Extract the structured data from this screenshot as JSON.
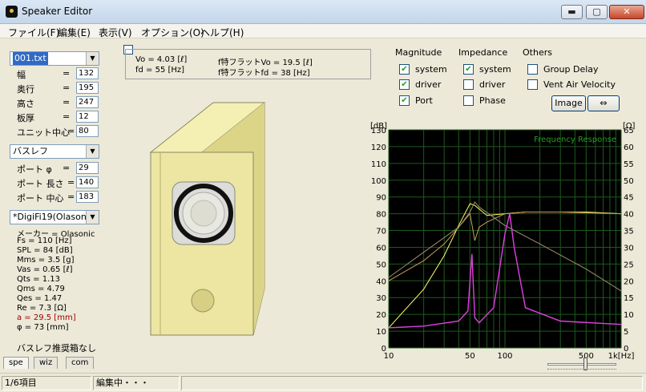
{
  "window": {
    "title": "Speaker Editor",
    "min": "▬",
    "max": "▢",
    "close": "✕"
  },
  "menu": [
    "ファイル(F)",
    "編集(E)",
    "表示(V)",
    "オプション(O)",
    "ヘルプ(H)"
  ],
  "box": {
    "file": "001.txt",
    "fields": [
      {
        "label": "幅",
        "value": "132"
      },
      {
        "label": "奥行",
        "value": "195"
      },
      {
        "label": "高さ",
        "value": "247"
      },
      {
        "label": "板厚",
        "value": "12"
      },
      {
        "label": "ユニット中心",
        "value": "80"
      }
    ]
  },
  "enclosure": {
    "type": "バスレフ",
    "fields": [
      {
        "label": "ポート φ",
        "value": "29"
      },
      {
        "label": "ポート 長さ",
        "value": "140"
      },
      {
        "label": "ポート 中心",
        "value": "183"
      }
    ]
  },
  "driver": {
    "name": "*DigiFi19(Olasonic",
    "specs": [
      "メーカー = Olasonic",
      "Fs   = 110 [Hz]",
      "SPL  = 84 [dB]",
      "Mms  = 3.5 [g]",
      "Vas  = 0.65 [ℓ]",
      "Qts  = 1.13",
      "Qms  = 4.79",
      "Qes  = 1.47",
      "Re   = 7.3 [Ω]"
    ],
    "specs_red": [
      "a    = 29.5 [mm]"
    ],
    "specs_tail": [
      "φ    = 73 [mm]"
    ],
    "note": "バスレフ推奨箱なし"
  },
  "tabs": [
    "spe",
    "wiz",
    "com"
  ],
  "info": {
    "vo": "Vo  = 4.03 [ℓ]",
    "fd": "fd  = 55 [Hz]",
    "flat_vo": "f特フラットVo = 19.5 [ℓ]",
    "flat_fd": "f特フラットfd = 38 [Hz]"
  },
  "options": {
    "magnitude": {
      "title": "Magnitude",
      "items": [
        {
          "label": "system",
          "checked": "✔"
        },
        {
          "label": "driver",
          "checked": "✔"
        },
        {
          "label": "Port",
          "checked": "✔"
        }
      ]
    },
    "impedance": {
      "title": "Impedance",
      "items": [
        {
          "label": "system",
          "checked": "✔"
        },
        {
          "label": "driver",
          "checked": ""
        },
        {
          "label": "Phase",
          "checked": ""
        }
      ]
    },
    "others": {
      "title": "Others",
      "items": [
        {
          "label": "Group Delay",
          "checked": ""
        },
        {
          "label": "Vent Air Velocity",
          "checked": ""
        }
      ]
    },
    "image_button": "Image",
    "swap_button": "⇔"
  },
  "chart_data": {
    "type": "line",
    "title": "Frequency Response",
    "left_unit": "[dB]",
    "right_unit": "[Ω]",
    "x_ticks": [
      "10",
      "50",
      "100",
      "500",
      "1k[Hz]"
    ],
    "x_log": true,
    "left_ticks": [
      130,
      120,
      110,
      100,
      90,
      80,
      70,
      60,
      50,
      40,
      30,
      20,
      10,
      0
    ],
    "right_ticks": [
      65,
      60,
      55,
      50,
      45,
      40,
      35,
      30,
      25,
      20,
      15,
      10,
      5,
      0
    ],
    "ylim_left": [
      0,
      130
    ],
    "ylim_right": [
      0,
      65
    ],
    "grid": true,
    "colors": {
      "background": "#000000",
      "grid": "#1e5a1e",
      "title": "#1fa01f",
      "system": "#ffff66",
      "driver": "#c8a060",
      "port": "#a09070",
      "impedance": "#e040e0"
    },
    "series": [
      {
        "name": "system",
        "x": [
          10,
          20,
          30,
          40,
          50,
          55,
          70,
          100,
          150,
          200,
          300,
          500,
          1000
        ],
        "y": [
          12,
          35,
          55,
          73,
          86,
          85,
          79,
          80,
          81,
          81,
          81,
          81,
          80
        ]
      },
      {
        "name": "driver",
        "x": [
          10,
          20,
          30,
          40,
          50,
          55,
          60,
          70,
          100,
          150,
          300,
          1000
        ],
        "y": [
          40,
          52,
          62,
          72,
          80,
          64,
          72,
          75,
          80,
          81,
          81,
          80
        ]
      },
      {
        "name": "Port",
        "x": [
          10,
          20,
          40,
          50,
          55,
          60,
          100,
          200,
          500,
          1000
        ],
        "y": [
          42,
          57,
          72,
          81,
          87,
          84,
          73,
          62,
          47,
          34
        ]
      },
      {
        "name": "impedance",
        "x": [
          10,
          20,
          40,
          48,
          52,
          55,
          60,
          80,
          100,
          110,
          120,
          150,
          300,
          1000
        ],
        "y": [
          6,
          6.5,
          8,
          11,
          28,
          9,
          7.5,
          12,
          34,
          40,
          30,
          12,
          8,
          7
        ]
      }
    ]
  },
  "status": {
    "items": "1/6項目",
    "mode": "編集中・・・"
  }
}
